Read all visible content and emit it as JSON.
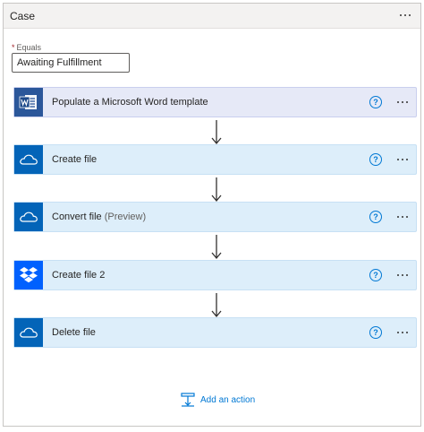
{
  "case": {
    "title": "Case",
    "equals_label": "Equals",
    "required_mark": "*",
    "equals_value": "Awaiting Fulfillment"
  },
  "steps": [
    {
      "title": "Populate a Microsoft Word template",
      "suffix": "",
      "icon": "word-icon",
      "color": "#2b579a"
    },
    {
      "title": "Create file",
      "suffix": "",
      "icon": "onedrive-icon",
      "color": "#0364b8"
    },
    {
      "title": "Convert file",
      "suffix": "(Preview)",
      "icon": "onedrive-icon",
      "color": "#0364b8"
    },
    {
      "title": "Create file 2",
      "suffix": "",
      "icon": "dropbox-icon",
      "color": "#0061fe"
    },
    {
      "title": "Delete file",
      "suffix": "",
      "icon": "onedrive-icon",
      "color": "#0364b8"
    }
  ],
  "help_glyph": "?",
  "add_action": {
    "label": "Add an action",
    "icon": "add-action-icon",
    "color": "#0078d4"
  }
}
